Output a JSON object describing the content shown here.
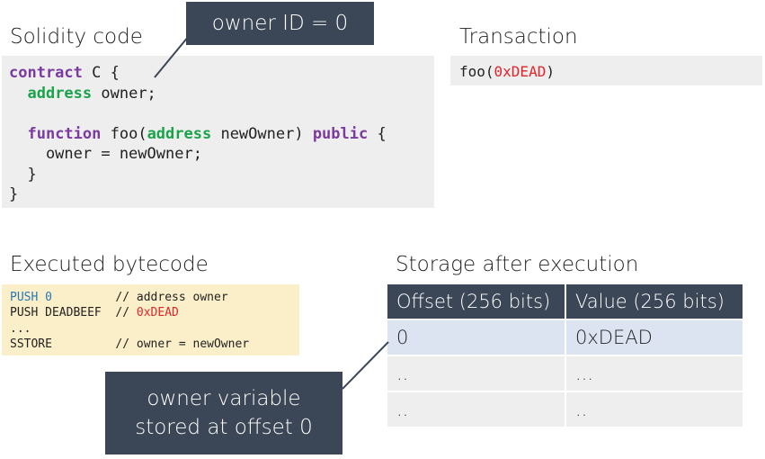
{
  "headings": {
    "solidity": "Solidity code",
    "transaction": "Transaction",
    "bytecode": "Executed bytecode",
    "storage": "Storage after execution"
  },
  "solidity": {
    "l1_kw": "contract",
    "l1_rest": " C {",
    "l2_pre": "  ",
    "l2_ty": "address",
    "l2_rest": " owner;",
    "l4_pre": "  ",
    "l4_kw": "function",
    "l4_mid": " foo(",
    "l4_ty": "address",
    "l4_mid2": " newOwner) ",
    "l4_kw2": "public",
    "l4_rest": " {",
    "l5": "    owner = newOwner;",
    "l6": "  }",
    "l7": "}"
  },
  "transaction": {
    "fn": "foo(",
    "arg": "0xDEAD",
    "close": ")"
  },
  "bytecode": {
    "l1_op": "PUSH 0",
    "l1_pad": "         ",
    "l1_comment": "// address owner",
    "l2_op": "PUSH DEADBEEF  ",
    "l2_comment": "// ",
    "l2_val": "0xDEAD",
    "l3": "...",
    "l4": "SSTORE         // owner = newOwner"
  },
  "storage": {
    "headers": [
      "Offset (256 bits)",
      "Value (256 bits)"
    ],
    "rows": [
      [
        "0",
        "0xDEAD"
      ],
      [
        "..",
        "..."
      ],
      [
        "..",
        ".."
      ]
    ]
  },
  "callouts": {
    "owner_id": "owner ID = 0",
    "owner_var_l1": "owner variable",
    "owner_var_l2": "stored at offset 0"
  },
  "colors": {
    "keyword": "#7a3aa0",
    "type": "#1aa34a",
    "value_red": "#e0262b",
    "push_blue": "#2676b8",
    "callout_bg": "#3b4656",
    "bytecode_bg": "#fbefc9",
    "code_bg": "#eeeeee",
    "highlight_row": "#dce4f2"
  }
}
